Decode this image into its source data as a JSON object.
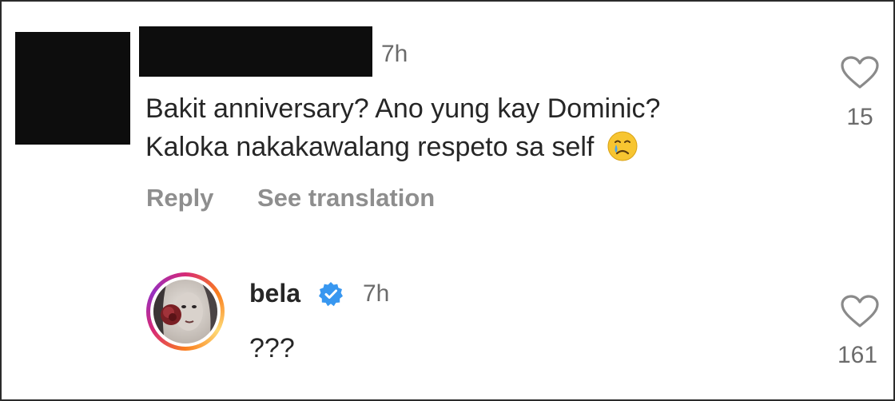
{
  "comment1": {
    "time": "7h",
    "line1": "Bakit anniversary? Ano yung kay Dominic?",
    "line2": "Kaloka nakakawalang respeto sa self",
    "emoji": "crying-face-emoji",
    "reply_label": "Reply",
    "translate_label": "See translation",
    "likes": "15"
  },
  "reply": {
    "username": "bela",
    "verified": true,
    "time": "7h",
    "text": "???",
    "likes": "161"
  },
  "colors": {
    "verified_blue": "#3897f0",
    "secondary_text": "#8e8e8e",
    "primary_text": "#262626",
    "ring_gradient": [
      "#d62976",
      "#fa7e1e",
      "#feda75",
      "#962fbf"
    ]
  },
  "icons": [
    "heart-icon",
    "verified-badge-icon",
    "crying-face-emoji"
  ]
}
